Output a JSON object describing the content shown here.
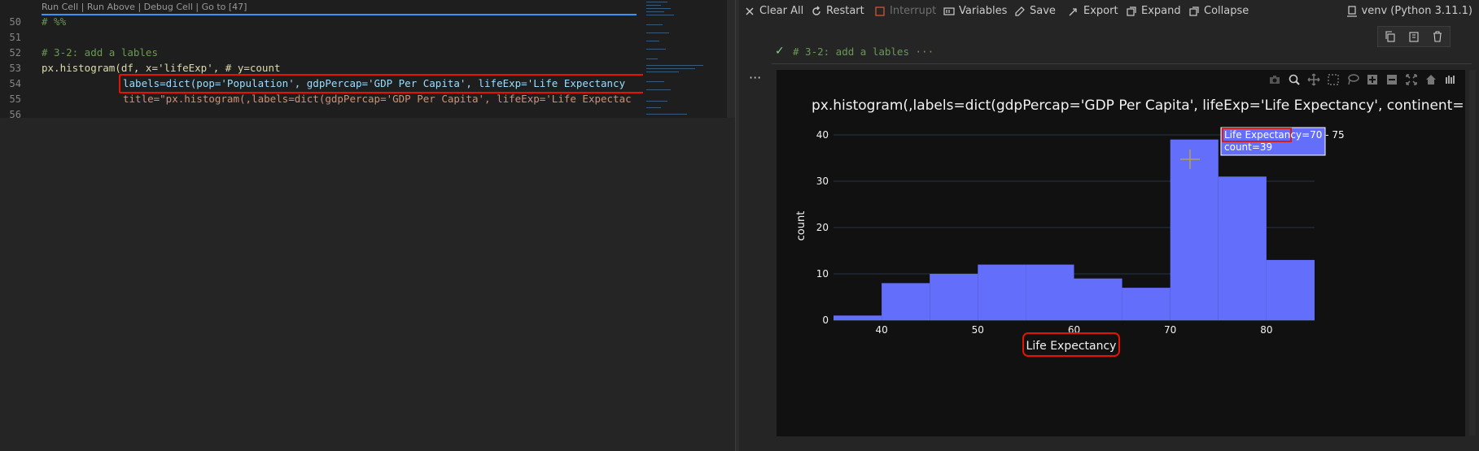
{
  "editor": {
    "codelens": "Run Cell | Run Above | Debug Cell | Go to [47]",
    "lines": [
      {
        "no": "50",
        "text": "# %%"
      },
      {
        "no": "51",
        "text": ""
      },
      {
        "no": "52",
        "text": "# 3-2: add a lables"
      },
      {
        "no": "53",
        "text": "px.histogram(df, x='lifeExp', # y=count"
      },
      {
        "no": "54",
        "text": "labels=dict(pop='Population', gdpPercap='GDP Per Capita', lifeExp='Life Expectancy"
      },
      {
        "no": "55",
        "text": "title=\"px.histogram(,labels=dict(gdpPercap='GDP Per Capita', lifeExp='Life Expectac"
      },
      {
        "no": "56",
        "text": ""
      }
    ]
  },
  "toolbar": {
    "clear_all": "Clear All",
    "restart": "Restart",
    "interrupt": "Interrupt",
    "variables": "Variables",
    "save": "Save",
    "export": "Export",
    "expand": "Expand",
    "collapse": "Collapse",
    "kernel": "venv (Python 3.11.1)"
  },
  "cell": {
    "summary": "# 3-2: add a lables ···",
    "more": "···"
  },
  "colors": {
    "bar": "#636efa",
    "highlight": "#e51400",
    "background": "#111111"
  },
  "chart_data": {
    "type": "bar",
    "title": "px.histogram(,labels=dict(gdpPercap='GDP Per Capita', lifeExp='Life Expectancy', continent=",
    "xlabel": "Life Expectancy",
    "ylabel": "count",
    "bins": [
      {
        "x0": 35,
        "x1": 40,
        "count": 1
      },
      {
        "x0": 40,
        "x1": 45,
        "count": 8
      },
      {
        "x0": 45,
        "x1": 50,
        "count": 10
      },
      {
        "x0": 50,
        "x1": 55,
        "count": 12
      },
      {
        "x0": 55,
        "x1": 60,
        "count": 12
      },
      {
        "x0": 60,
        "x1": 65,
        "count": 9
      },
      {
        "x0": 65,
        "x1": 70,
        "count": 7
      },
      {
        "x0": 70,
        "x1": 75,
        "count": 39
      },
      {
        "x0": 75,
        "x1": 80,
        "count": 31
      },
      {
        "x0": 80,
        "x1": 85,
        "count": 13
      }
    ],
    "xlim": [
      35,
      85
    ],
    "ylim": [
      0,
      40
    ],
    "xticks": [
      40,
      50,
      60,
      70,
      80
    ],
    "yticks": [
      0,
      10,
      20,
      30,
      40
    ],
    "grid": true,
    "tooltip": {
      "label": "Life Expectancy",
      "range": "=70 - 75",
      "count": "count=39"
    }
  }
}
